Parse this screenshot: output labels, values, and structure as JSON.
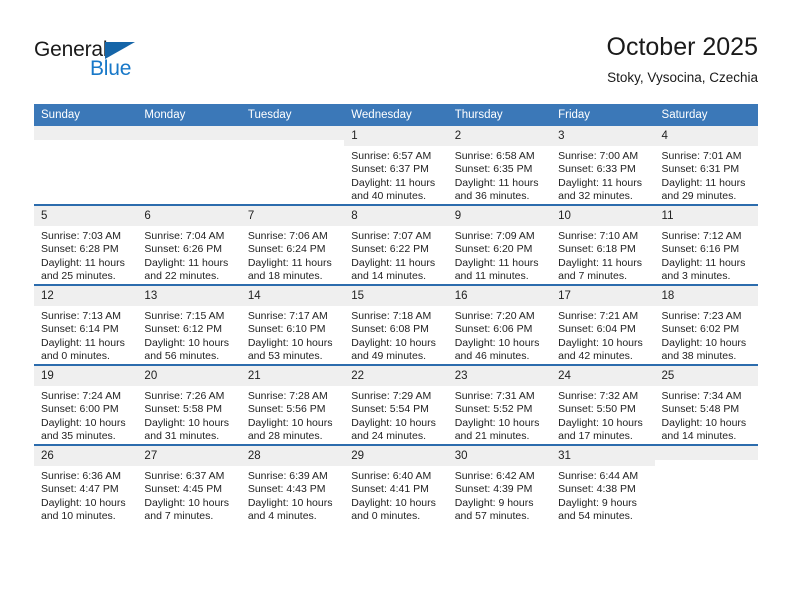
{
  "logo": {
    "word_top": "General",
    "word_bottom": "Blue",
    "triangle_color": "#1565a8",
    "blue_color": "#1878c8"
  },
  "header": {
    "title": "October 2025",
    "subtitle": "Stoky, Vysocina, Czechia"
  },
  "colors": {
    "header_row_bg": "#3b78b8",
    "row_divider": "#2c6cad",
    "daynum_bg": "#efefef",
    "text": "#222222"
  },
  "weekday_headers": [
    "Sunday",
    "Monday",
    "Tuesday",
    "Wednesday",
    "Thursday",
    "Friday",
    "Saturday"
  ],
  "labels": {
    "sunrise": "Sunrise:",
    "sunset": "Sunset:",
    "daylight": "Daylight:"
  },
  "weeks": [
    [
      {
        "day": "",
        "blank": true
      },
      {
        "day": "",
        "blank": true
      },
      {
        "day": "",
        "blank": true
      },
      {
        "day": "1",
        "sunrise": "Sunrise: 6:57 AM",
        "sunset": "Sunset: 6:37 PM",
        "daylight_1": "Daylight: 11 hours",
        "daylight_2": "and 40 minutes."
      },
      {
        "day": "2",
        "sunrise": "Sunrise: 6:58 AM",
        "sunset": "Sunset: 6:35 PM",
        "daylight_1": "Daylight: 11 hours",
        "daylight_2": "and 36 minutes."
      },
      {
        "day": "3",
        "sunrise": "Sunrise: 7:00 AM",
        "sunset": "Sunset: 6:33 PM",
        "daylight_1": "Daylight: 11 hours",
        "daylight_2": "and 32 minutes."
      },
      {
        "day": "4",
        "sunrise": "Sunrise: 7:01 AM",
        "sunset": "Sunset: 6:31 PM",
        "daylight_1": "Daylight: 11 hours",
        "daylight_2": "and 29 minutes."
      }
    ],
    [
      {
        "day": "5",
        "sunrise": "Sunrise: 7:03 AM",
        "sunset": "Sunset: 6:28 PM",
        "daylight_1": "Daylight: 11 hours",
        "daylight_2": "and 25 minutes."
      },
      {
        "day": "6",
        "sunrise": "Sunrise: 7:04 AM",
        "sunset": "Sunset: 6:26 PM",
        "daylight_1": "Daylight: 11 hours",
        "daylight_2": "and 22 minutes."
      },
      {
        "day": "7",
        "sunrise": "Sunrise: 7:06 AM",
        "sunset": "Sunset: 6:24 PM",
        "daylight_1": "Daylight: 11 hours",
        "daylight_2": "and 18 minutes."
      },
      {
        "day": "8",
        "sunrise": "Sunrise: 7:07 AM",
        "sunset": "Sunset: 6:22 PM",
        "daylight_1": "Daylight: 11 hours",
        "daylight_2": "and 14 minutes."
      },
      {
        "day": "9",
        "sunrise": "Sunrise: 7:09 AM",
        "sunset": "Sunset: 6:20 PM",
        "daylight_1": "Daylight: 11 hours",
        "daylight_2": "and 11 minutes."
      },
      {
        "day": "10",
        "sunrise": "Sunrise: 7:10 AM",
        "sunset": "Sunset: 6:18 PM",
        "daylight_1": "Daylight: 11 hours",
        "daylight_2": "and 7 minutes."
      },
      {
        "day": "11",
        "sunrise": "Sunrise: 7:12 AM",
        "sunset": "Sunset: 6:16 PM",
        "daylight_1": "Daylight: 11 hours",
        "daylight_2": "and 3 minutes."
      }
    ],
    [
      {
        "day": "12",
        "sunrise": "Sunrise: 7:13 AM",
        "sunset": "Sunset: 6:14 PM",
        "daylight_1": "Daylight: 11 hours",
        "daylight_2": "and 0 minutes."
      },
      {
        "day": "13",
        "sunrise": "Sunrise: 7:15 AM",
        "sunset": "Sunset: 6:12 PM",
        "daylight_1": "Daylight: 10 hours",
        "daylight_2": "and 56 minutes."
      },
      {
        "day": "14",
        "sunrise": "Sunrise: 7:17 AM",
        "sunset": "Sunset: 6:10 PM",
        "daylight_1": "Daylight: 10 hours",
        "daylight_2": "and 53 minutes."
      },
      {
        "day": "15",
        "sunrise": "Sunrise: 7:18 AM",
        "sunset": "Sunset: 6:08 PM",
        "daylight_1": "Daylight: 10 hours",
        "daylight_2": "and 49 minutes."
      },
      {
        "day": "16",
        "sunrise": "Sunrise: 7:20 AM",
        "sunset": "Sunset: 6:06 PM",
        "daylight_1": "Daylight: 10 hours",
        "daylight_2": "and 46 minutes."
      },
      {
        "day": "17",
        "sunrise": "Sunrise: 7:21 AM",
        "sunset": "Sunset: 6:04 PM",
        "daylight_1": "Daylight: 10 hours",
        "daylight_2": "and 42 minutes."
      },
      {
        "day": "18",
        "sunrise": "Sunrise: 7:23 AM",
        "sunset": "Sunset: 6:02 PM",
        "daylight_1": "Daylight: 10 hours",
        "daylight_2": "and 38 minutes."
      }
    ],
    [
      {
        "day": "19",
        "sunrise": "Sunrise: 7:24 AM",
        "sunset": "Sunset: 6:00 PM",
        "daylight_1": "Daylight: 10 hours",
        "daylight_2": "and 35 minutes."
      },
      {
        "day": "20",
        "sunrise": "Sunrise: 7:26 AM",
        "sunset": "Sunset: 5:58 PM",
        "daylight_1": "Daylight: 10 hours",
        "daylight_2": "and 31 minutes."
      },
      {
        "day": "21",
        "sunrise": "Sunrise: 7:28 AM",
        "sunset": "Sunset: 5:56 PM",
        "daylight_1": "Daylight: 10 hours",
        "daylight_2": "and 28 minutes."
      },
      {
        "day": "22",
        "sunrise": "Sunrise: 7:29 AM",
        "sunset": "Sunset: 5:54 PM",
        "daylight_1": "Daylight: 10 hours",
        "daylight_2": "and 24 minutes."
      },
      {
        "day": "23",
        "sunrise": "Sunrise: 7:31 AM",
        "sunset": "Sunset: 5:52 PM",
        "daylight_1": "Daylight: 10 hours",
        "daylight_2": "and 21 minutes."
      },
      {
        "day": "24",
        "sunrise": "Sunrise: 7:32 AM",
        "sunset": "Sunset: 5:50 PM",
        "daylight_1": "Daylight: 10 hours",
        "daylight_2": "and 17 minutes."
      },
      {
        "day": "25",
        "sunrise": "Sunrise: 7:34 AM",
        "sunset": "Sunset: 5:48 PM",
        "daylight_1": "Daylight: 10 hours",
        "daylight_2": "and 14 minutes."
      }
    ],
    [
      {
        "day": "26",
        "sunrise": "Sunrise: 6:36 AM",
        "sunset": "Sunset: 4:47 PM",
        "daylight_1": "Daylight: 10 hours",
        "daylight_2": "and 10 minutes."
      },
      {
        "day": "27",
        "sunrise": "Sunrise: 6:37 AM",
        "sunset": "Sunset: 4:45 PM",
        "daylight_1": "Daylight: 10 hours",
        "daylight_2": "and 7 minutes."
      },
      {
        "day": "28",
        "sunrise": "Sunrise: 6:39 AM",
        "sunset": "Sunset: 4:43 PM",
        "daylight_1": "Daylight: 10 hours",
        "daylight_2": "and 4 minutes."
      },
      {
        "day": "29",
        "sunrise": "Sunrise: 6:40 AM",
        "sunset": "Sunset: 4:41 PM",
        "daylight_1": "Daylight: 10 hours",
        "daylight_2": "and 0 minutes."
      },
      {
        "day": "30",
        "sunrise": "Sunrise: 6:42 AM",
        "sunset": "Sunset: 4:39 PM",
        "daylight_1": "Daylight: 9 hours",
        "daylight_2": "and 57 minutes."
      },
      {
        "day": "31",
        "sunrise": "Sunrise: 6:44 AM",
        "sunset": "Sunset: 4:38 PM",
        "daylight_1": "Daylight: 9 hours",
        "daylight_2": "and 54 minutes."
      },
      {
        "day": "",
        "blank": true
      }
    ]
  ]
}
